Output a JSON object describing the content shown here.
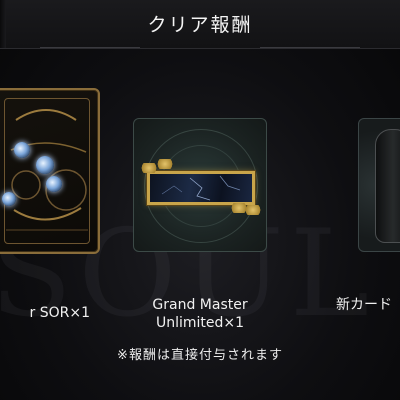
{
  "header": {
    "title": "クリア報酬"
  },
  "rewards": [
    {
      "label": "r SOR×1",
      "icon": "card-sleeve-icon"
    },
    {
      "label_line1": "Grand Master",
      "label_line2": "Unlimited×1",
      "icon": "title-nameplate-icon"
    },
    {
      "label": "新カード",
      "icon": "card-art-icon"
    }
  ],
  "note": "※報酬は直接付与されます",
  "watermark": "SOUL W",
  "colors": {
    "gold": "#c9a54a",
    "background": "#0b0b0d",
    "text": "#f2f2f2"
  }
}
